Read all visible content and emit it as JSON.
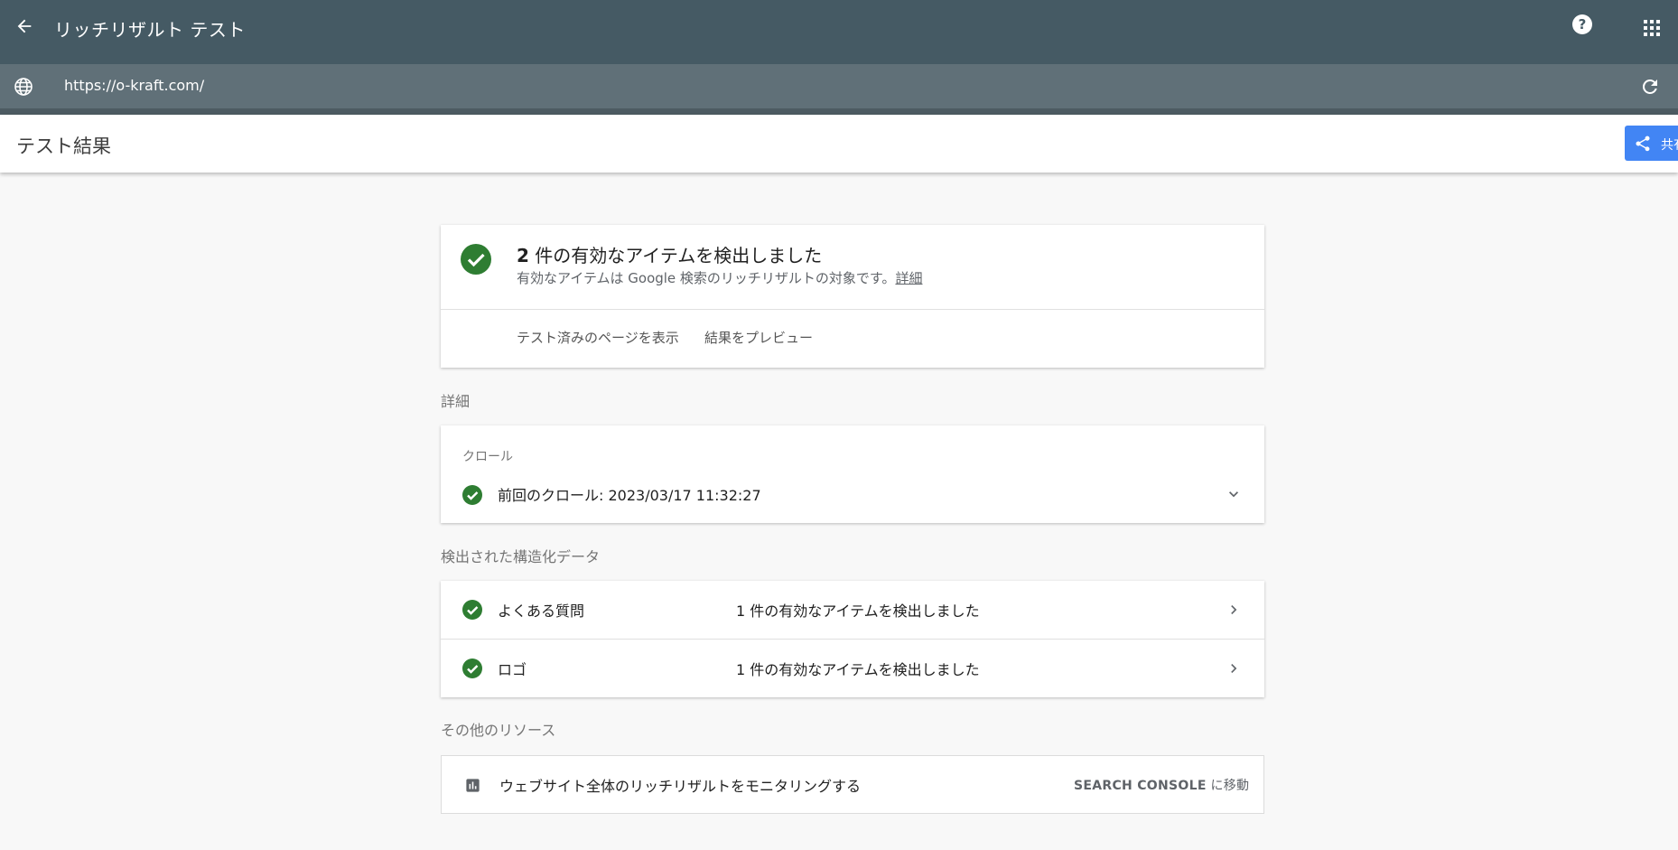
{
  "appbar": {
    "title": "リッチリザルト テスト"
  },
  "urlbar": {
    "url": "https://o-kraft.com/"
  },
  "subheader": {
    "title": "テスト結果",
    "share_label": "共有"
  },
  "summary": {
    "count": "2",
    "headline_rest": " 件の有効なアイテムを検出しました",
    "description": "有効なアイテムは Google 検索のリッチリザルトの対象です。",
    "details_link": "詳細",
    "view_tested_page": "テスト済みのページを表示",
    "preview_results": "結果をプレビュー"
  },
  "details": {
    "section_label": "詳細",
    "crawl_label": "クロール",
    "last_crawl": "前回のクロール: 2023/03/17 11:32:27"
  },
  "structured_data": {
    "section_label": "検出された構造化データ",
    "items": [
      {
        "name": "よくある質問",
        "status": "1 件の有効なアイテムを検出しました"
      },
      {
        "name": "ロゴ",
        "status": "1 件の有効なアイテムを検出しました"
      }
    ]
  },
  "other_resources": {
    "section_label": "その他のリソース",
    "text": "ウェブサイト全体のリッチリザルトをモニタリングする",
    "cta_main": "SEARCH CONSOLE",
    "cta_suffix": " に移動"
  },
  "icons": {
    "back": "arrow-back-icon",
    "help": "help-icon",
    "apps": "apps-grid-icon",
    "globe": "globe-icon",
    "reload": "refresh-icon",
    "share": "share-icon",
    "check": "check-circle-icon",
    "expand": "chevron-down-icon",
    "navigate": "chevron-right-icon",
    "chart": "bar-chart-icon"
  },
  "colors": {
    "appbar": "#455a64",
    "urlbar": "#607078",
    "success": "#2e7d32",
    "share_button": "#4285f4",
    "background": "#f8f8f8"
  }
}
